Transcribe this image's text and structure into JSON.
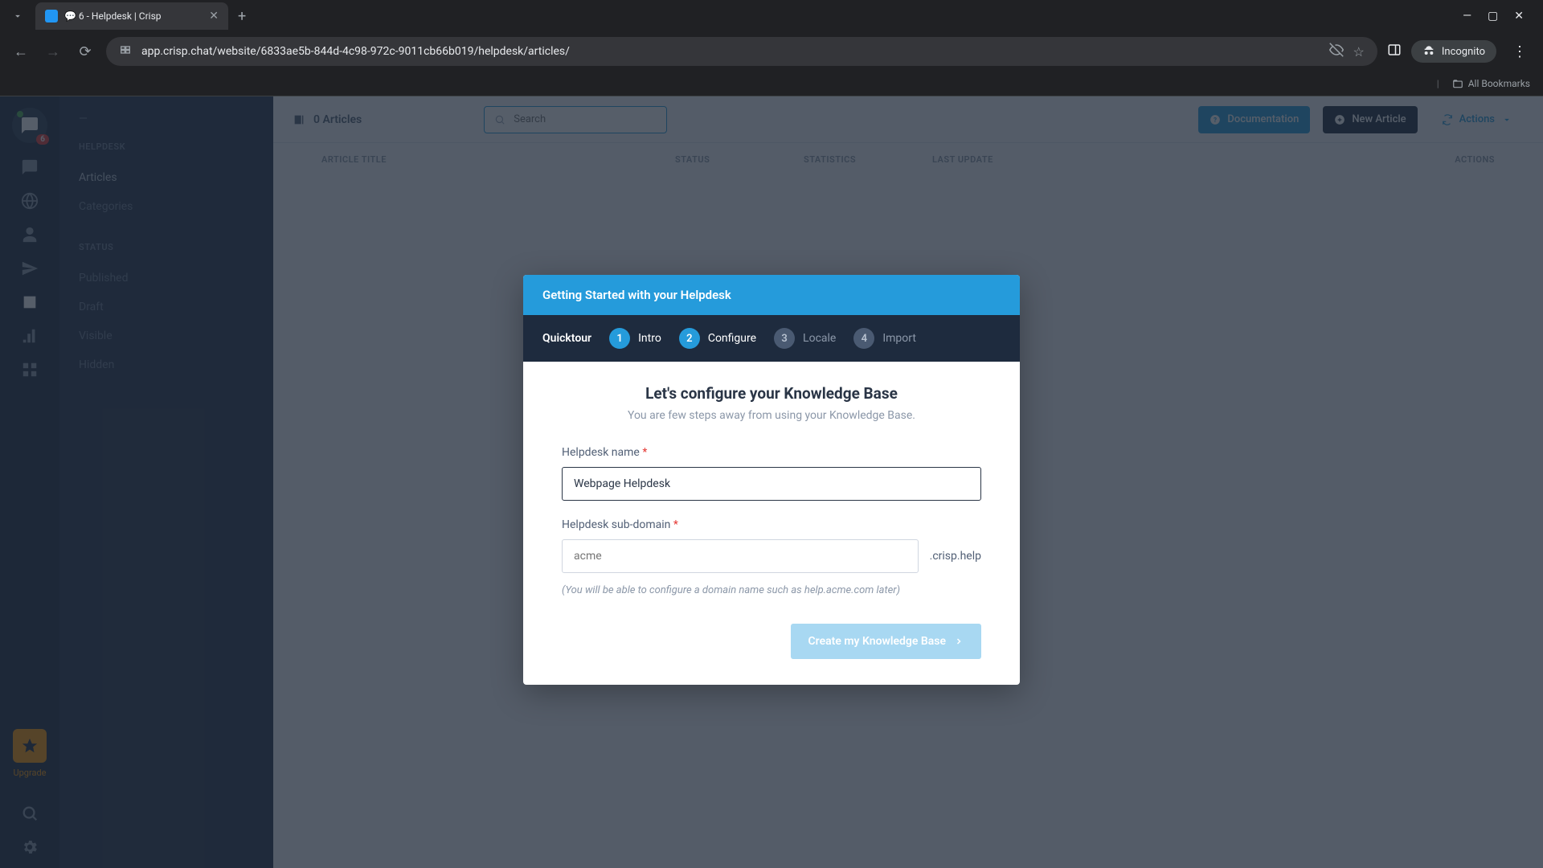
{
  "browser": {
    "tab_title": "💬 6 - Helpdesk | Crisp",
    "url": "app.crisp.chat/website/6833ae5b-844d-4c98-972c-9011cb66b019/helpdesk/articles/",
    "incognito_label": "Incognito",
    "all_bookmarks_label": "All Bookmarks",
    "badge_count": "6"
  },
  "sidebar": {
    "upgrade_label": "Upgrade"
  },
  "secondary_sidebar": {
    "dash": "—",
    "section_helpdesk": "HELPDESK",
    "item_articles": "Articles",
    "item_categories": "Categories",
    "section_status": "STATUS",
    "item_published": "Published",
    "item_draft": "Draft",
    "item_visible": "Visible",
    "item_hidden": "Hidden"
  },
  "main": {
    "article_count": "0 Articles",
    "search_placeholder": "Search",
    "btn_documentation": "Documentation",
    "btn_new_article": "New Article",
    "btn_actions": "Actions",
    "th_title": "ARTICLE TITLE",
    "th_status": "STATUS",
    "th_stats": "STATISTICS",
    "th_update": "LAST UPDATE",
    "th_actions": "ACTIONS"
  },
  "modal": {
    "header": "Getting Started with your Helpdesk",
    "quicktour": "Quicktour",
    "steps": [
      {
        "num": "1",
        "label": "Intro",
        "state": "done"
      },
      {
        "num": "2",
        "label": "Configure",
        "state": "active"
      },
      {
        "num": "3",
        "label": "Locale",
        "state": "pending"
      },
      {
        "num": "4",
        "label": "Import",
        "state": "pending"
      }
    ],
    "title": "Let's configure your Knowledge Base",
    "subtitle": "You are few steps away from using your Knowledge Base.",
    "field_name_label": "Helpdesk name",
    "field_name_value": "Webpage Helpdesk",
    "field_subdomain_label": "Helpdesk sub-domain",
    "field_subdomain_placeholder": "acme",
    "subdomain_suffix": ".crisp.help",
    "hint": "(You will be able to configure a domain name such as help.acme.com later)",
    "create_button": "Create my Knowledge Base"
  }
}
